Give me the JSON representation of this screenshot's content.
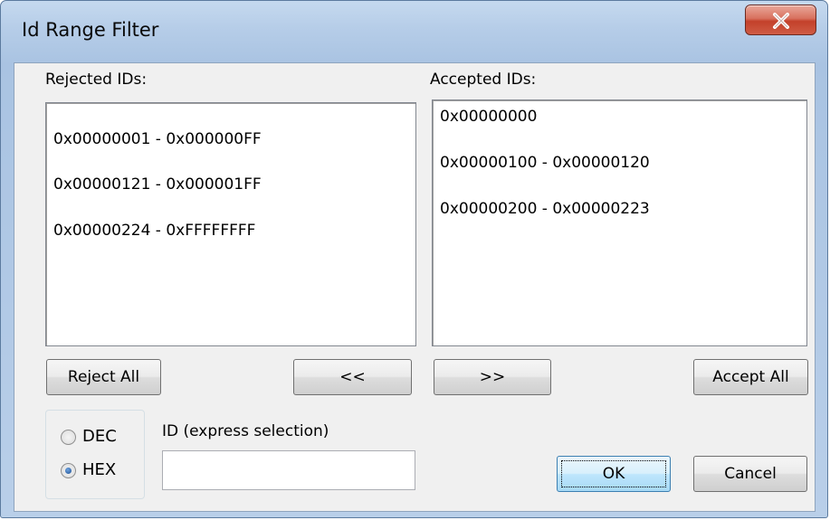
{
  "window": {
    "title": "Id Range Filter"
  },
  "rejected": {
    "label": "Rejected IDs:",
    "items": [
      "0x00000001 - 0x000000FF",
      "0x00000121 - 0x000001FF",
      "0x00000224 - 0xFFFFFFFF"
    ]
  },
  "accepted": {
    "label": "Accepted IDs:",
    "items": [
      "0x00000000",
      "0x00000100 - 0x00000120",
      "0x00000200 - 0x00000223"
    ]
  },
  "buttons": {
    "reject_all": "Reject All",
    "move_left": "<<",
    "move_right": ">>",
    "accept_all": "Accept All",
    "ok": "OK",
    "cancel": "Cancel"
  },
  "format": {
    "dec_label": "DEC",
    "hex_label": "HEX",
    "selected": "HEX"
  },
  "express": {
    "label": "ID (express selection)",
    "value": ""
  },
  "icons": {
    "close": "close-icon"
  },
  "colors": {
    "close_button": "#c3402a",
    "title_bar": "#b6cde8",
    "dialog_bg": "#f0f0f0"
  }
}
